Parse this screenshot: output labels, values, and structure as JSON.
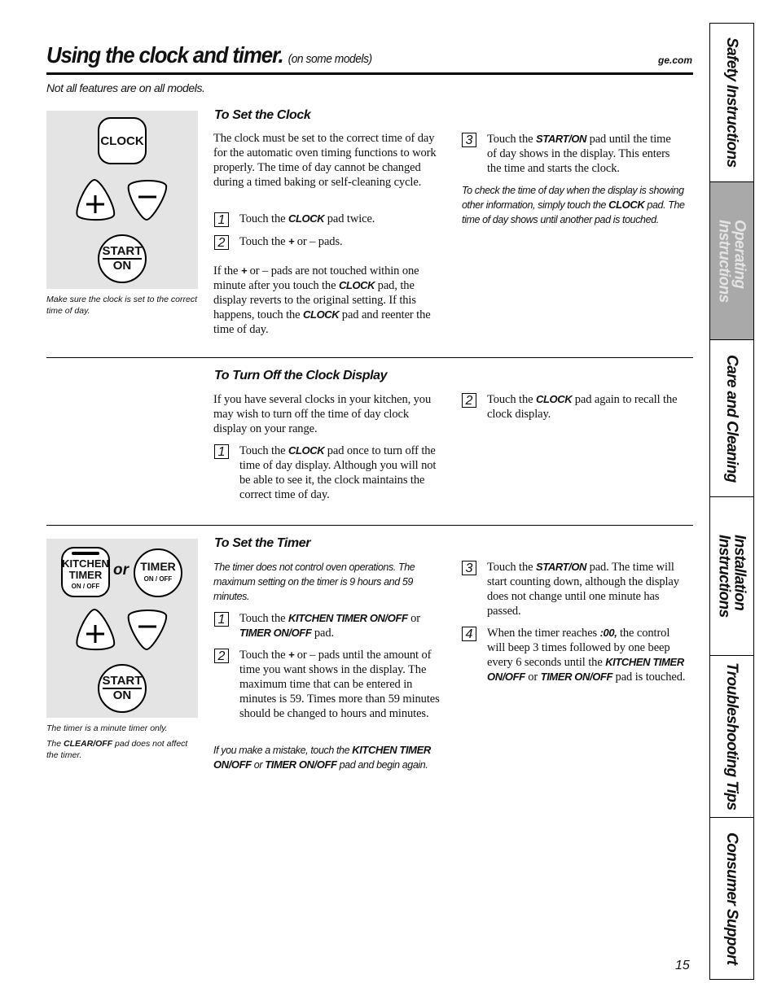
{
  "header": {
    "title": "Using the clock and timer.",
    "subtitle": "(on some models)",
    "site": "ge.com",
    "note": "Not all features are on all models."
  },
  "clock_panel": {
    "pads": {
      "clock": "CLOCK",
      "plus": "+",
      "minus": "–",
      "start": "START",
      "on": "ON"
    },
    "caption": "Make sure the clock is set to the correct time of day."
  },
  "set_clock": {
    "heading": "To Set the Clock",
    "intro": "The clock must be set to the correct time of day for the automatic oven timing functions to work properly. The time of day cannot be changed during a timed baking or self-cleaning cycle.",
    "steps": [
      {
        "num": "1",
        "pre": "Touch the ",
        "kw": "CLOCK",
        "post": " pad twice."
      },
      {
        "num": "2",
        "pre": "Touch the ",
        "kw": "+",
        "post": " or – pads."
      },
      {
        "num": "3",
        "pre": "Touch the ",
        "kw": "START/ON",
        "post": " pad until the time of day shows in the display. This enters the time and starts the clock."
      }
    ],
    "warning": {
      "p1": "If the ",
      "k1": "+",
      "p2": " or – pads are not touched within one minute after you touch the ",
      "k2": "CLOCK",
      "p3": " pad, the display reverts to the original setting. If this happens, touch the ",
      "k3": "CLOCK",
      "p4": " pad and reenter the time of day."
    },
    "tip": {
      "p1": "To check the time of day when the display is showing other information, simply touch the ",
      "k1": "CLOCK",
      "p2": " pad. The time of day shows until another pad is touched."
    }
  },
  "turn_off": {
    "heading": "To Turn Off the Clock Display",
    "intro": "If you have several clocks in your kitchen, you may wish to turn off the time of day clock display on your range.",
    "steps": [
      {
        "num": "1",
        "pre": "Touch the ",
        "kw": "CLOCK",
        "post": " pad once to turn off the time of day display. Although you will not be able to see it, the clock maintains the correct time of day."
      },
      {
        "num": "2",
        "pre": "Touch the ",
        "kw": "CLOCK",
        "post": " pad again to recall the clock display."
      }
    ]
  },
  "timer_panel": {
    "pads": {
      "kitchen": "KITCHEN",
      "timer": "TIMER",
      "onoff": "ON / OFF",
      "or": "or",
      "timer2": "TIMER",
      "onoff2": "ON / OFF",
      "plus": "+",
      "minus": "–",
      "start": "START",
      "on": "ON"
    },
    "caption1": "The timer is a minute timer only.",
    "caption2": {
      "p1": "The ",
      "k1": "CLEAR/OFF",
      "p2": " pad does not affect the timer."
    }
  },
  "set_timer": {
    "heading": "To Set the Timer",
    "intro": "The timer does not control oven operations. The maximum setting on the timer is 9 hours and 59 minutes.",
    "step1": {
      "num": "1",
      "pre": "Touch the ",
      "k1": "KITCHEN TIMER ON/OFF",
      "mid": " or ",
      "k2": "TIMER ON/OFF",
      "post": " pad."
    },
    "step2": {
      "num": "2",
      "pre": "Touch the ",
      "kw": "+",
      "post": " or – pads until the amount of time you want shows in the display. The maximum time that can be entered in minutes is 59. Times more than 59 minutes should be changed to hours and minutes."
    },
    "step3": {
      "num": "3",
      "pre": "Touch the ",
      "kw": "START/ON",
      "post": " pad. The time will start counting down, although the display does not change until one minute has passed."
    },
    "step4": {
      "num": "4",
      "pre": "When the timer reaches ",
      "k0": ":00,",
      "mid": " the control will beep 3 times followed by one beep every 6 seconds until the ",
      "k1": "KITCHEN TIMER ON/OFF",
      "mid2": " or ",
      "k2": "TIMER ON/OFF",
      "post": " pad is touched."
    },
    "mistake": {
      "p1": "If you make a mistake, touch the ",
      "k1": "KITCHEN TIMER ON/OFF",
      "p2": " or ",
      "k2": "TIMER ON/OFF",
      "p3": " pad and begin again."
    }
  },
  "side_tabs": [
    {
      "label": "Safety Instructions",
      "active": false
    },
    {
      "label": "Operating\nInstructions",
      "active": true
    },
    {
      "label": "Care and Cleaning",
      "active": false
    },
    {
      "label": "Installation\nInstructions",
      "active": false
    },
    {
      "label": "Troubleshooting Tips",
      "active": false
    },
    {
      "label": "Consumer Support",
      "active": false
    }
  ],
  "page_number": "15"
}
